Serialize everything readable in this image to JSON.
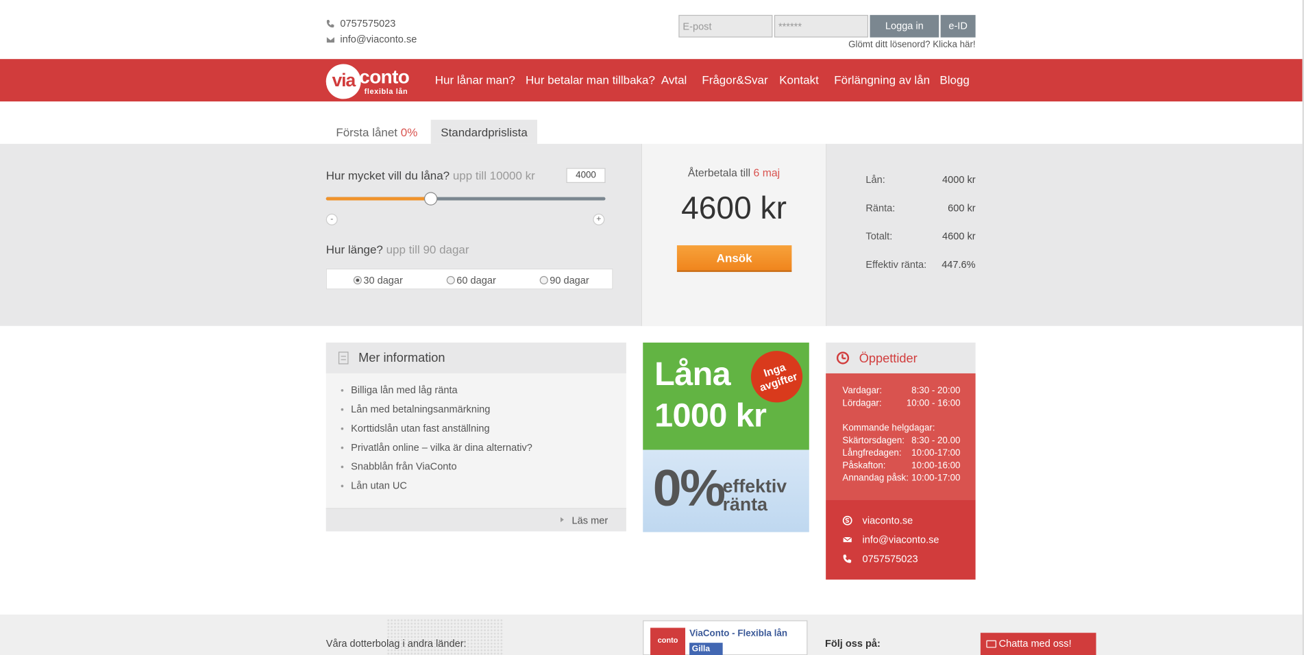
{
  "contact": {
    "phone": "0757575023",
    "email": "info@viaconto.se"
  },
  "login": {
    "email_placeholder": "E-post",
    "password_placeholder": "******",
    "login_button": "Logga in",
    "eid_button": "e-ID",
    "forgot_text": "Glömt ditt lösenord? Klicka här!"
  },
  "logo": {
    "mark": "via",
    "word": "conto",
    "tagline": "flexibla lån"
  },
  "nav": [
    "Hur lånar man?",
    "Hur betalar man tillbaka?",
    "Avtal",
    "Frågor&Svar",
    "Kontakt",
    "Förlängning av lån",
    "Blogg"
  ],
  "tabs": {
    "first_loan": "Första lånet",
    "first_loan_accent": "0%",
    "standard": "Standardprislista"
  },
  "calculator": {
    "amount_question": "Hur mycket vill du låna?",
    "amount_hint": "upp till 10000 kr",
    "amount_value": "4000",
    "amount_fraction": 0.375,
    "minus": "-",
    "plus": "+",
    "duration_question": "Hur länge?",
    "duration_hint": "upp till 90 dagar",
    "options": [
      "30 dagar",
      "60 dagar",
      "90 dagar"
    ],
    "selected_option": 0,
    "repay_label": "Återbetala till",
    "repay_date": "6 maj",
    "total": "4600 kr",
    "apply": "Ansök"
  },
  "summary": [
    {
      "label": "Lån:",
      "value": "4000 kr"
    },
    {
      "label": "Ränta:",
      "value": "600 kr"
    },
    {
      "label": "Totalt:",
      "value": "4600 kr"
    },
    {
      "label": "Effektiv ränta:",
      "value": "447.6%"
    }
  ],
  "info": {
    "title": "Mer information",
    "items": [
      "Billiga lån med låg ränta",
      "Lån med betalningsanmärkning",
      "Korttidslån utan fast anställning",
      "Privatlån online – vilka är dina alternativ?",
      "Snabblån från ViaConto",
      "Lån utan UC"
    ],
    "read_more": "Läs mer"
  },
  "promo": {
    "line1": "Låna",
    "line2": "1000 kr",
    "badge_line1": "Inga",
    "badge_line2": "avgifter",
    "zero": "0%",
    "small1": "effektiv",
    "small2": "ränta"
  },
  "hours": {
    "title": "Öppettider",
    "regular": [
      {
        "day": "Vardagar:",
        "time": "8:30 - 20:00"
      },
      {
        "day": "Lördagar:",
        "time": "10:00 - 16:00"
      }
    ],
    "holiday_title": "Kommande helgdagar:",
    "holidays": [
      {
        "day": "Skärtorsdagen:",
        "time": "8:30 - 20.00"
      },
      {
        "day": "Långfredagen:",
        "time": "10:00-17:00"
      },
      {
        "day": "Påskafton:",
        "time": "10:00-16:00"
      },
      {
        "day": "Annandag påsk:",
        "time": "10:00-17:00"
      }
    ],
    "skype": "viaconto.se",
    "email": "info@viaconto.se",
    "phone": "0757575023"
  },
  "footer": {
    "subsidiaries": "Våra dotterbolag i andra länder:",
    "fb_name": "ViaConto - Flexibla lån",
    "fb_like": "Gilla",
    "follow": "Följ oss på:",
    "chat": "Chatta med oss!"
  },
  "colors": {
    "brand_red": "#d13c3c",
    "apply_orange": "#f0932b",
    "accent_red_text": "#d9534f",
    "promo_green": "#62b443"
  }
}
